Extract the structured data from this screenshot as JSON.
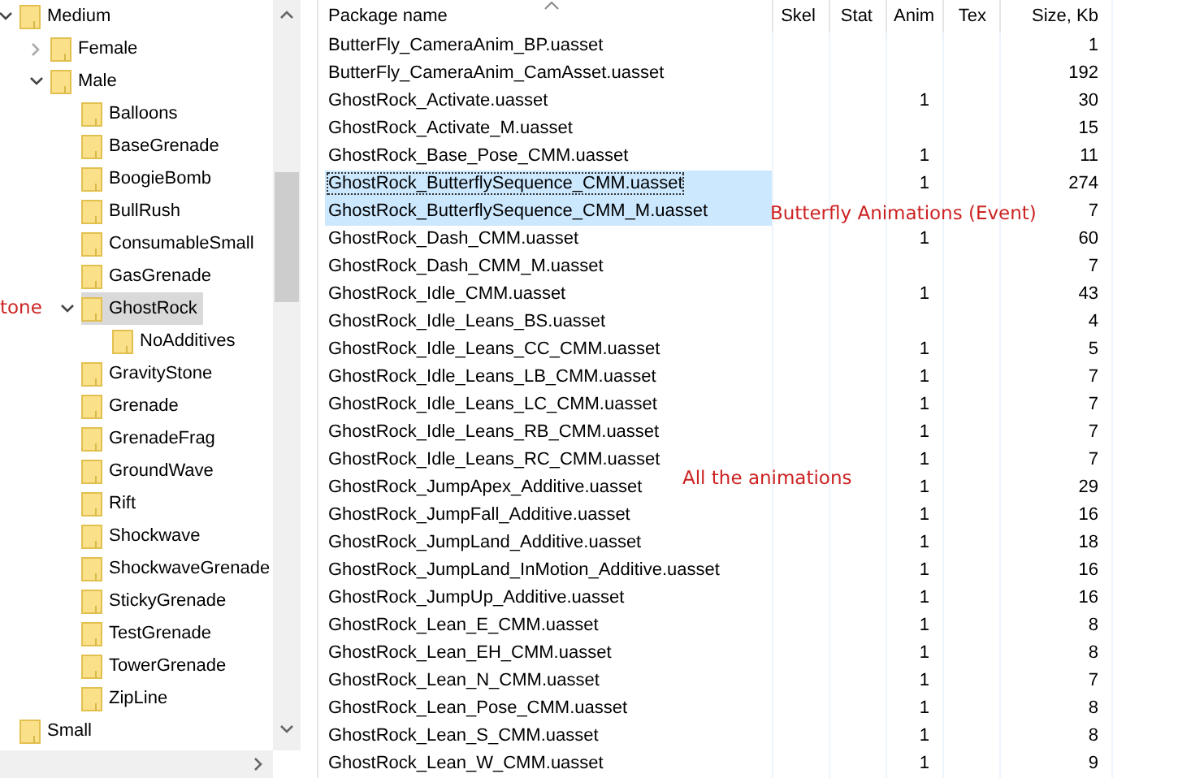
{
  "tree": [
    {
      "label": "Medium",
      "expanded": true,
      "selected": false,
      "children": [
        {
          "label": "Female",
          "expanded": false,
          "selected": false
        },
        {
          "label": "Male",
          "expanded": true,
          "selected": false,
          "children": [
            {
              "label": "Balloons",
              "selected": false
            },
            {
              "label": "BaseGrenade",
              "selected": false
            },
            {
              "label": "BoogieBomb",
              "selected": false
            },
            {
              "label": "BullRush",
              "selected": false
            },
            {
              "label": "ConsumableSmall",
              "selected": false
            },
            {
              "label": "GasGrenade",
              "selected": false
            },
            {
              "label": "GhostRock",
              "expanded": true,
              "selected": true,
              "children": [
                {
                  "label": "NoAdditives",
                  "selected": false
                }
              ]
            },
            {
              "label": "GravityStone",
              "selected": false
            },
            {
              "label": "Grenade",
              "selected": false
            },
            {
              "label": "GrenadeFrag",
              "selected": false
            },
            {
              "label": "GroundWave",
              "selected": false
            },
            {
              "label": "Rift",
              "selected": false
            },
            {
              "label": "Shockwave",
              "selected": false
            },
            {
              "label": "ShockwaveGrenade",
              "selected": false
            },
            {
              "label": "StickyGrenade",
              "selected": false
            },
            {
              "label": "TestGrenade",
              "selected": false
            },
            {
              "label": "TowerGrenade",
              "selected": false
            },
            {
              "label": "ZipLine",
              "selected": false
            }
          ]
        }
      ]
    },
    {
      "label": "Small",
      "selected": false
    }
  ],
  "table": {
    "columns": [
      "Package name",
      "Skel",
      "Stat",
      "Anim",
      "Tex",
      "Size, Kb"
    ],
    "rows": [
      {
        "name": "ButterFly_CameraAnim_BP.uasset",
        "size": "1",
        "selected": false,
        "focused": false
      },
      {
        "name": "ButterFly_CameraAnim_CamAsset.uasset",
        "size": "192",
        "selected": false,
        "focused": false
      },
      {
        "name": "GhostRock_Activate.uasset",
        "anim": "1",
        "size": "30",
        "selected": false,
        "focused": false
      },
      {
        "name": "GhostRock_Activate_M.uasset",
        "size": "15",
        "selected": false,
        "focused": false
      },
      {
        "name": "GhostRock_Base_Pose_CMM.uasset",
        "anim": "1",
        "size": "11",
        "selected": false,
        "focused": false
      },
      {
        "name": "GhostRock_ButterflySequence_CMM.uasset",
        "anim": "1",
        "size": "274",
        "selected": true,
        "focused": true
      },
      {
        "name": "GhostRock_ButterflySequence_CMM_M.uasset",
        "size": "7",
        "selected": true,
        "focused": false
      },
      {
        "name": "GhostRock_Dash_CMM.uasset",
        "anim": "1",
        "size": "60",
        "selected": false,
        "focused": false
      },
      {
        "name": "GhostRock_Dash_CMM_M.uasset",
        "size": "7",
        "selected": false,
        "focused": false
      },
      {
        "name": "GhostRock_Idle_CMM.uasset",
        "anim": "1",
        "size": "43",
        "selected": false,
        "focused": false
      },
      {
        "name": "GhostRock_Idle_Leans_BS.uasset",
        "size": "4",
        "selected": false,
        "focused": false
      },
      {
        "name": "GhostRock_Idle_Leans_CC_CMM.uasset",
        "anim": "1",
        "size": "5",
        "selected": false,
        "focused": false
      },
      {
        "name": "GhostRock_Idle_Leans_LB_CMM.uasset",
        "anim": "1",
        "size": "7",
        "selected": false,
        "focused": false
      },
      {
        "name": "GhostRock_Idle_Leans_LC_CMM.uasset",
        "anim": "1",
        "size": "7",
        "selected": false,
        "focused": false
      },
      {
        "name": "GhostRock_Idle_Leans_RB_CMM.uasset",
        "anim": "1",
        "size": "7",
        "selected": false,
        "focused": false
      },
      {
        "name": "GhostRock_Idle_Leans_RC_CMM.uasset",
        "anim": "1",
        "size": "7",
        "selected": false,
        "focused": false
      },
      {
        "name": "GhostRock_JumpApex_Additive.uasset",
        "anim": "1",
        "size": "29",
        "selected": false,
        "focused": false
      },
      {
        "name": "GhostRock_JumpFall_Additive.uasset",
        "anim": "1",
        "size": "16",
        "selected": false,
        "focused": false
      },
      {
        "name": "GhostRock_JumpLand_Additive.uasset",
        "anim": "1",
        "size": "18",
        "selected": false,
        "focused": false
      },
      {
        "name": "GhostRock_JumpLand_InMotion_Additive.uasset",
        "anim": "1",
        "size": "16",
        "selected": false,
        "focused": false
      },
      {
        "name": "GhostRock_JumpUp_Additive.uasset",
        "anim": "1",
        "size": "16",
        "selected": false,
        "focused": false
      },
      {
        "name": "GhostRock_Lean_E_CMM.uasset",
        "anim": "1",
        "size": "8",
        "selected": false,
        "focused": false
      },
      {
        "name": "GhostRock_Lean_EH_CMM.uasset",
        "anim": "1",
        "size": "8",
        "selected": false,
        "focused": false
      },
      {
        "name": "GhostRock_Lean_N_CMM.uasset",
        "anim": "1",
        "size": "7",
        "selected": false,
        "focused": false
      },
      {
        "name": "GhostRock_Lean_Pose_CMM.uasset",
        "anim": "1",
        "size": "8",
        "selected": false,
        "focused": false
      },
      {
        "name": "GhostRock_Lean_S_CMM.uasset",
        "anim": "1",
        "size": "8",
        "selected": false,
        "focused": false
      },
      {
        "name": "GhostRock_Lean_W_CMM.uasset",
        "anim": "1",
        "size": "9",
        "selected": false,
        "focused": false
      }
    ]
  },
  "annotations": [
    {
      "kind": "left",
      "text": "tone"
    },
    {
      "kind": "butterfly",
      "text": "Butterfly Animations (Event)"
    },
    {
      "kind": "all",
      "text": "All the animations"
    }
  ]
}
